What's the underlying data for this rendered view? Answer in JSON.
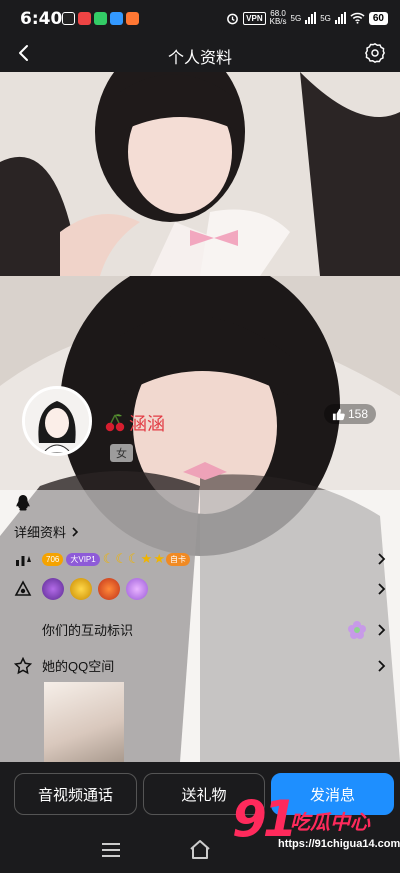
{
  "status_bar": {
    "time": "6:40",
    "vpn": "VPN",
    "net_speed_value": "68.0",
    "net_speed_unit": "KB/s",
    "net1": "5G",
    "net2": "5G",
    "battery": "60"
  },
  "header": {
    "title": "个人资料"
  },
  "profile": {
    "nickname": "涵涵",
    "gender": "女",
    "likes": "158"
  },
  "sections": {
    "detail_label": "详细资料",
    "level_badge": "706",
    "vip_badge": "大VIP1",
    "extra_badge": "自卡",
    "interaction_label": "你们的互动标识",
    "qzone_label": "她的QQ空间"
  },
  "actions": {
    "call": "音视频通话",
    "gift": "送礼物",
    "message": "发消息"
  },
  "watermark": {
    "number": "91",
    "brand": "吃瓜中心",
    "url": "https://91chigua14.com"
  },
  "colors": {
    "bar_bg": "#1b1b1d",
    "primary": "#1e8fff",
    "nickname": "#e23c45"
  }
}
